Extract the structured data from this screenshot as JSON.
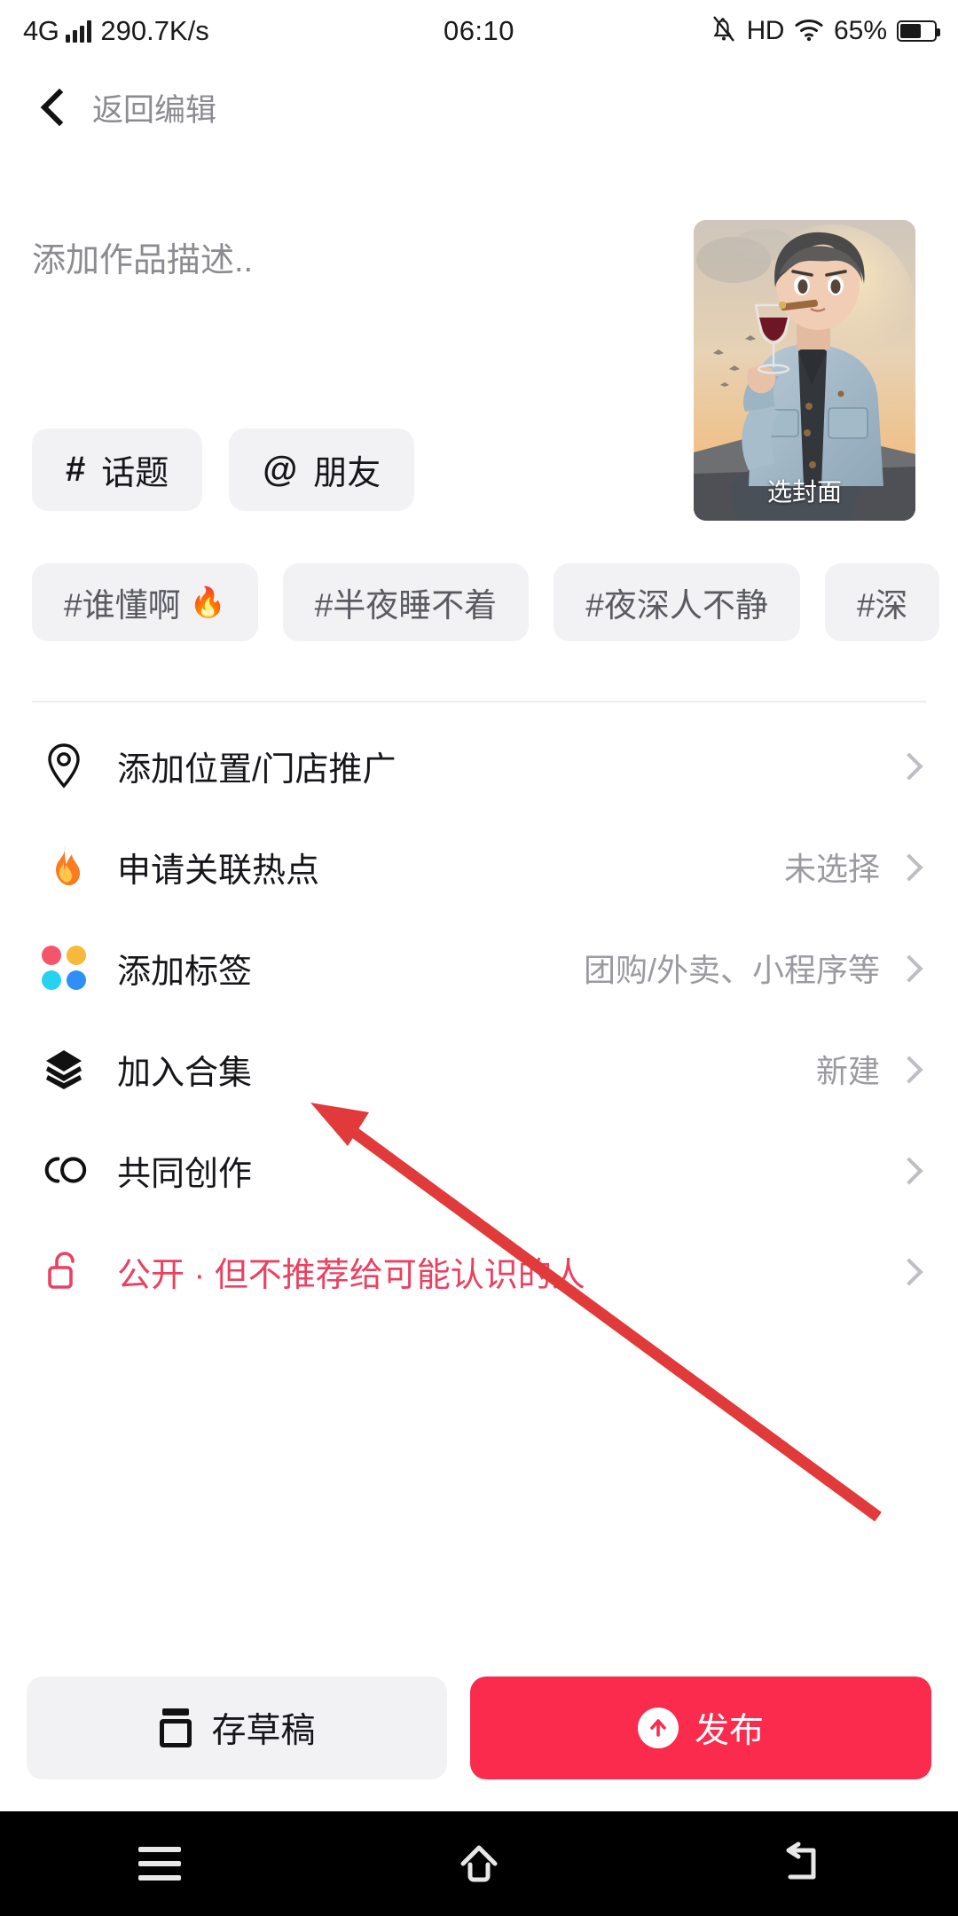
{
  "statusbar": {
    "network_type": "4G",
    "speed": "290.7K/s",
    "time": "06:10",
    "hd": "HD",
    "battery_percent": "65%",
    "mute_icon": "bell-muted-icon",
    "wifi_icon": "wifi-icon",
    "battery_icon": "battery-icon"
  },
  "header": {
    "back_icon": "chevron-left-icon",
    "title": "返回编辑"
  },
  "composer": {
    "placeholder": "添加作品描述..",
    "cover_label": "选封面"
  },
  "pills": [
    {
      "symbol": "#",
      "label": "话题",
      "name": "topic"
    },
    {
      "symbol": "@",
      "label": "朋友",
      "name": "friend"
    }
  ],
  "suggested_tags": [
    {
      "text": "#谁懂啊",
      "flame": "🔥"
    },
    {
      "text": "#半夜睡不着",
      "flame": ""
    },
    {
      "text": "#夜深人不静",
      "flame": ""
    },
    {
      "text": "#深",
      "flame": ""
    }
  ],
  "rows": [
    {
      "icon": "location-pin-icon",
      "label": "添加位置/门店推广",
      "value": ""
    },
    {
      "icon": "flame-icon",
      "label": "申请关联热点",
      "value": "未选择"
    },
    {
      "icon": "four-dots-icon",
      "label": "添加标签",
      "value": "团购/外卖、小程序等"
    },
    {
      "icon": "layers-icon",
      "label": "加入合集",
      "value": "新建"
    },
    {
      "icon": "co-create-icon",
      "label": "共同创作",
      "value": ""
    },
    {
      "icon": "unlock-icon",
      "label": "公开 · 但不推荐给可能认识的人",
      "value": ""
    }
  ],
  "actions": {
    "draft_label": "存草稿",
    "publish_label": "发布"
  },
  "navbar": {
    "recents": "menu-icon",
    "home": "home-icon",
    "back": "back-arrow-icon"
  },
  "colors": {
    "accent_red": "#FA2B4D",
    "privacy_text": "#EC4060",
    "chip_bg": "#F2F2F4",
    "muted_text": "#9A9AA1",
    "annotation_arrow": "#E03A3A",
    "dot_red": "#F4556A",
    "dot_orange": "#F6B93B",
    "dot_cyan": "#25D3F0",
    "dot_blue": "#2F8FF5"
  }
}
